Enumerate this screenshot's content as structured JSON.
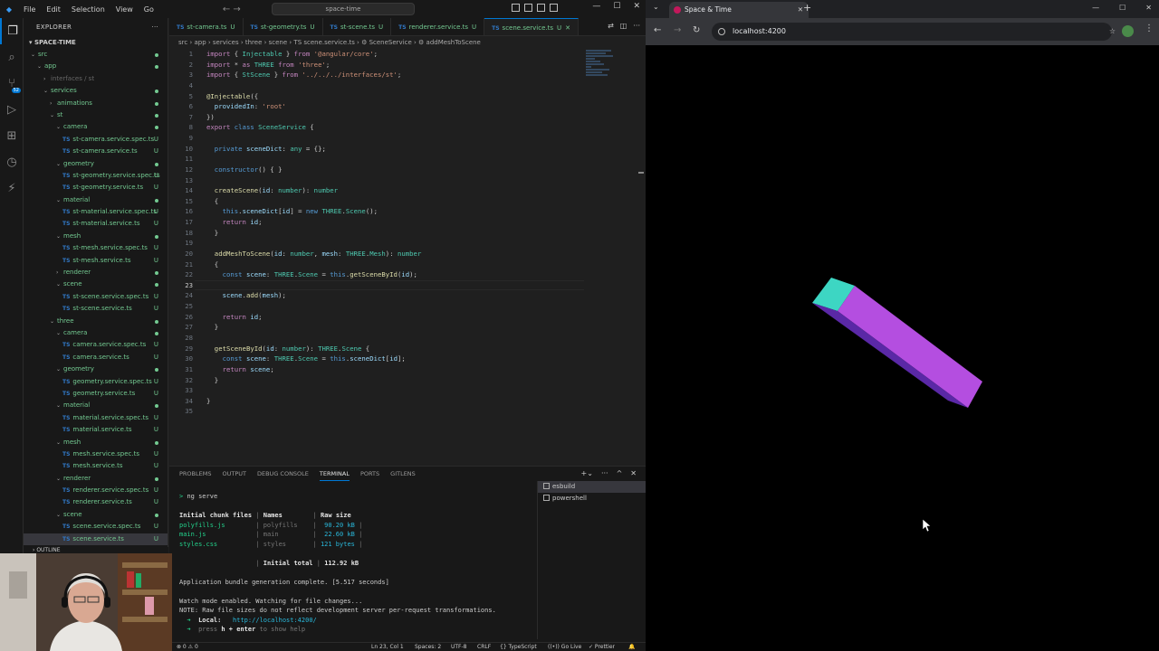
{
  "vscode": {
    "menu": [
      "File",
      "Edit",
      "Selection",
      "View",
      "Go"
    ],
    "search_text": "space-time",
    "explorer_title": "EXPLORER",
    "project": "SPACE-TIME",
    "tree": [
      {
        "label": "src",
        "depth": 0,
        "type": "folder",
        "open": true,
        "status": "dot"
      },
      {
        "label": "app",
        "depth": 1,
        "type": "folder",
        "open": true,
        "status": "dot"
      },
      {
        "label": "interfaces / st",
        "depth": 2,
        "type": "folder",
        "dim": true,
        "status": ""
      },
      {
        "label": "services",
        "depth": 2,
        "type": "folder",
        "open": true,
        "status": "dot"
      },
      {
        "label": "animations",
        "depth": 3,
        "type": "folder",
        "open": false,
        "status": "dot"
      },
      {
        "label": "st",
        "depth": 3,
        "type": "folder",
        "open": true,
        "status": "dot"
      },
      {
        "label": "camera",
        "depth": 4,
        "type": "folder",
        "open": true,
        "status": "dot"
      },
      {
        "label": "st-camera.service.spec.ts",
        "depth": 5,
        "type": "ts",
        "status": "U"
      },
      {
        "label": "st-camera.service.ts",
        "depth": 5,
        "type": "ts",
        "status": "U"
      },
      {
        "label": "geometry",
        "depth": 4,
        "type": "folder",
        "open": true,
        "status": "dot"
      },
      {
        "label": "st-geometry.service.spec.ts",
        "depth": 5,
        "type": "ts",
        "status": "U"
      },
      {
        "label": "st-geometry.service.ts",
        "depth": 5,
        "type": "ts",
        "status": "U"
      },
      {
        "label": "material",
        "depth": 4,
        "type": "folder",
        "open": true,
        "status": "dot"
      },
      {
        "label": "st-material.service.spec.ts",
        "depth": 5,
        "type": "ts",
        "status": "U"
      },
      {
        "label": "st-material.service.ts",
        "depth": 5,
        "type": "ts",
        "status": "U"
      },
      {
        "label": "mesh",
        "depth": 4,
        "type": "folder",
        "open": true,
        "status": "dot"
      },
      {
        "label": "st-mesh.service.spec.ts",
        "depth": 5,
        "type": "ts",
        "status": "U"
      },
      {
        "label": "st-mesh.service.ts",
        "depth": 5,
        "type": "ts",
        "status": "U"
      },
      {
        "label": "renderer",
        "depth": 4,
        "type": "folder",
        "open": false,
        "status": "dot"
      },
      {
        "label": "scene",
        "depth": 4,
        "type": "folder",
        "open": true,
        "status": "dot"
      },
      {
        "label": "st-scene.service.spec.ts",
        "depth": 5,
        "type": "ts",
        "status": "U"
      },
      {
        "label": "st-scene.service.ts",
        "depth": 5,
        "type": "ts",
        "status": "U"
      },
      {
        "label": "three",
        "depth": 3,
        "type": "folder",
        "open": true,
        "status": "dot"
      },
      {
        "label": "camera",
        "depth": 4,
        "type": "folder",
        "open": true,
        "status": "dot"
      },
      {
        "label": "camera.service.spec.ts",
        "depth": 5,
        "type": "ts",
        "status": "U"
      },
      {
        "label": "camera.service.ts",
        "depth": 5,
        "type": "ts",
        "status": "U"
      },
      {
        "label": "geometry",
        "depth": 4,
        "type": "folder",
        "open": true,
        "status": "dot"
      },
      {
        "label": "geometry.service.spec.ts",
        "depth": 5,
        "type": "ts",
        "status": "U"
      },
      {
        "label": "geometry.service.ts",
        "depth": 5,
        "type": "ts",
        "status": "U"
      },
      {
        "label": "material",
        "depth": 4,
        "type": "folder",
        "open": true,
        "status": "dot"
      },
      {
        "label": "material.service.spec.ts",
        "depth": 5,
        "type": "ts",
        "status": "U"
      },
      {
        "label": "material.service.ts",
        "depth": 5,
        "type": "ts",
        "status": "U"
      },
      {
        "label": "mesh",
        "depth": 4,
        "type": "folder",
        "open": true,
        "status": "dot"
      },
      {
        "label": "mesh.service.spec.ts",
        "depth": 5,
        "type": "ts",
        "status": "U"
      },
      {
        "label": "mesh.service.ts",
        "depth": 5,
        "type": "ts",
        "status": "U"
      },
      {
        "label": "renderer",
        "depth": 4,
        "type": "folder",
        "open": true,
        "status": "dot"
      },
      {
        "label": "renderer.service.spec.ts",
        "depth": 5,
        "type": "ts",
        "status": "U"
      },
      {
        "label": "renderer.service.ts",
        "depth": 5,
        "type": "ts",
        "status": "U"
      },
      {
        "label": "scene",
        "depth": 4,
        "type": "folder",
        "open": true,
        "status": "dot"
      },
      {
        "label": "scene.service.spec.ts",
        "depth": 5,
        "type": "ts",
        "status": "U"
      },
      {
        "label": "scene.service.ts",
        "depth": 5,
        "type": "ts",
        "status": "U",
        "selected": true
      },
      {
        "label": "utilities",
        "depth": 2,
        "type": "folder",
        "open": false,
        "dim": true,
        "status": ""
      }
    ],
    "outline_label": "OUTLINE",
    "tabs": [
      {
        "label": "st-camera.ts",
        "status": "U"
      },
      {
        "label": "st-geometry.ts",
        "status": "U"
      },
      {
        "label": "st-scene.ts",
        "status": "U"
      },
      {
        "label": "renderer.service.ts",
        "status": "U"
      },
      {
        "label": "scene.service.ts",
        "status": "U",
        "active": true
      }
    ],
    "breadcrumb": "src › app › services › three › scene › TS scene.service.ts › ⚙ SceneService › ⚙ addMeshToScene",
    "current_line": 23,
    "code": [
      "<k>import</k> { <t>Injectable</t> } <k>from</k> <s>'@angular/core'</s>;",
      "<k>import</k> * <k>as</k> <t>THREE</t> <k>from</k> <s>'three'</s>;",
      "<k>import</k> { <t>StScene</t> } <k>from</k> <s>'../../../interfaces/st'</s>;",
      "",
      "<f>@Injectable</f>({",
      "  <v>providedIn</v>: <s>'root'</s>",
      "})",
      "<k>export</k> <b>class</b> <t>SceneService</t> {",
      "",
      "  <b>private</b> <v>sceneDict</v>: <t>any</t> = {};",
      "",
      "  <b>constructor</b>() { }",
      "",
      "  <f>createScene</f>(<v>id</v>: <t>number</t>): <t>number</t>",
      "  {",
      "    <b>this</b>.<v>sceneDict</v>[<v>id</v>] = <b>new</b> <t>THREE</t>.<t>Scene</t>();",
      "    <k>return</k> <v>id</v>;",
      "  }",
      "",
      "  <f>addMeshToScene</f>(<v>id</v>: <t>number</t>, <v>mesh</v>: <t>THREE</t>.<t>Mesh</t>): <t>number</t>",
      "  {",
      "    <b>const</b> <v>scene</v>: <t>THREE</t>.<t>Scene</t> = <b>this</b>.<f>getSceneById</f>(<v>id</v>);",
      "",
      "    <v>scene</v>.<f>add</f>(<v>mesh</v>);",
      "",
      "    <k>return</k> <v>id</v>;",
      "  }",
      "",
      "  <f>getSceneById</f>(<v>id</v>: <t>number</t>): <t>THREE</t>.<t>Scene</t> {",
      "    <b>const</b> <v>scene</v>: <t>THREE</t>.<t>Scene</t> = <b>this</b>.<v>sceneDict</v>[<v>id</v>];",
      "    <k>return</k> <v>scene</v>;",
      "  }",
      "",
      "}",
      ""
    ],
    "panel_tabs": [
      "PROBLEMS",
      "OUTPUT",
      "DEBUG CONSOLE",
      "TERMINAL",
      "PORTS",
      "GITLENS"
    ],
    "panel_active": "TERMINAL",
    "terminal_lines": [
      [
        [
          "g",
          "> "
        ],
        [
          "",
          "ng serve"
        ]
      ],
      [
        [
          "",
          ""
        ]
      ],
      [
        [
          "b",
          "Initial chunk files"
        ],
        [
          "gr",
          " | "
        ],
        [
          "b",
          "Names"
        ],
        [
          "gr",
          "        | "
        ],
        [
          "b",
          "Raw size"
        ]
      ],
      [
        [
          "g",
          "polyfills.js"
        ],
        [
          "gr",
          "        | polyfills    | "
        ],
        [
          "c",
          " 90.20 kB"
        ],
        [
          "gr",
          " |"
        ]
      ],
      [
        [
          "g",
          "main.js"
        ],
        [
          "gr",
          "             | main         | "
        ],
        [
          "c",
          " 22.60 kB"
        ],
        [
          "gr",
          " |"
        ]
      ],
      [
        [
          "g",
          "styles.css"
        ],
        [
          "gr",
          "          | styles       | "
        ],
        [
          "c",
          "121 bytes"
        ],
        [
          "gr",
          " |"
        ]
      ],
      [
        [
          "",
          ""
        ]
      ],
      [
        [
          "",
          "                    "
        ],
        [
          "gr",
          "| "
        ],
        [
          "b",
          "Initial total"
        ],
        [
          "gr",
          " | "
        ],
        [
          "b",
          "112.92 kB"
        ]
      ],
      [
        [
          "",
          ""
        ]
      ],
      [
        [
          "",
          "Application bundle generation complete. [5.517 seconds]"
        ]
      ],
      [
        [
          "",
          ""
        ]
      ],
      [
        [
          "",
          "Watch mode enabled. Watching for file changes..."
        ]
      ],
      [
        [
          "",
          "NOTE: Raw file sizes do not reflect development server per-request transformations."
        ]
      ],
      [
        [
          "g",
          "  ➜  "
        ],
        [
          "b",
          "Local:"
        ],
        [
          "",
          "   "
        ],
        [
          "c",
          "http://localhost:4200/"
        ]
      ],
      [
        [
          "g",
          "  ➜  "
        ],
        [
          "gr",
          "press "
        ],
        [
          "b",
          "h + enter"
        ],
        [
          "gr",
          " to show help"
        ]
      ],
      [
        [
          "",
          ""
        ]
      ]
    ],
    "terminal_list": [
      {
        "label": "esbuild",
        "active": true
      },
      {
        "label": "powershell",
        "active": false
      }
    ],
    "status": {
      "problems": "⊗ 0 ⚠ 0",
      "position": "Ln 23, Col 1",
      "spaces": "Spaces: 2",
      "encoding": "UTF-8",
      "eol": "CRLF",
      "language": "{} TypeScript",
      "golive": "((•)) Go Live",
      "prettier": "✓ Prettier",
      "bell": "🔔"
    }
  },
  "browser": {
    "tab_title": "Space & Time",
    "url": "localhost:4200"
  },
  "colors": {
    "box_top": "#3dd6c3",
    "box_side": "#b44ee0",
    "box_front": "#5a28a6",
    "accent": "#0078d4"
  }
}
